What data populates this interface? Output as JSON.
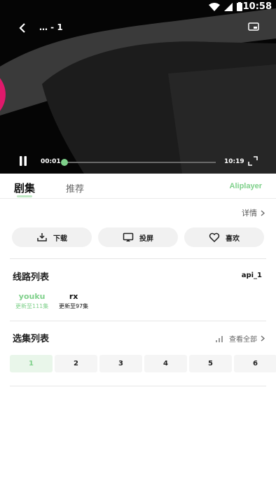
{
  "status_bar": {
    "time": "10:58"
  },
  "player": {
    "title": "… - 1",
    "current_time": "00:01",
    "duration": "10:19",
    "progress": 0.01
  },
  "tabs": {
    "active": "剧集",
    "inactive": "推荐",
    "brand": "Aliplayer"
  },
  "info": {
    "show_name": "",
    "detail_label": "详情"
  },
  "actions": [
    {
      "label": "下载",
      "icon": "download-icon"
    },
    {
      "label": "投屏",
      "icon": "cast-icon"
    },
    {
      "label": "喜欢",
      "icon": "heart-icon"
    }
  ],
  "routes": {
    "title": "线路列表",
    "api": "api_1",
    "items": [
      {
        "name": "youku",
        "sub": "更新至111集",
        "active": true
      },
      {
        "name": "rx",
        "sub": "更新至97集",
        "active": false
      }
    ]
  },
  "episodes": {
    "title": "选集列表",
    "view_all": "查看全部",
    "items": [
      "1",
      "2",
      "3",
      "4",
      "5",
      "6"
    ],
    "selected_index": 0
  },
  "colors": {
    "accent": "#7ed08a",
    "accent_bg": "#e9f6ea",
    "video_bg": "#000000"
  }
}
